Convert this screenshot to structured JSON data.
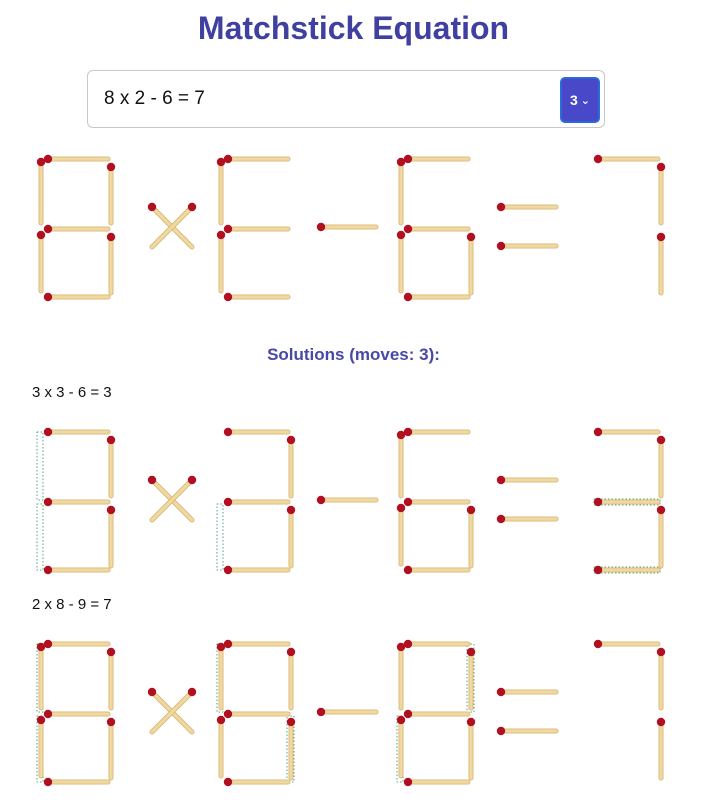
{
  "title": "Matchstick Equation",
  "equation_input": {
    "value": "8 x 2 - 6 = 7"
  },
  "moves_select": {
    "value": "3"
  },
  "colors": {
    "accent": "#4040a0",
    "stick": "#f0d9a0",
    "stick_edge": "#d8b978",
    "head": "#b01020",
    "ghost": "#2e8b57"
  },
  "puzzle": {
    "symbols": [
      {
        "kind": "digit",
        "on": [
          0,
          1,
          2,
          3,
          4,
          5,
          6
        ]
      },
      {
        "kind": "times"
      },
      {
        "kind": "digit",
        "on": [
          0,
          1,
          3,
          4,
          6
        ]
      },
      {
        "kind": "minus"
      },
      {
        "kind": "digit",
        "on": [
          0,
          1,
          3,
          4,
          5,
          6
        ]
      },
      {
        "kind": "equals"
      },
      {
        "kind": "digit",
        "on": [
          0,
          2,
          5
        ]
      }
    ]
  },
  "solutions_title": "Solutions (moves: 3):",
  "solutions": [
    {
      "label": "3 x 3 - 6 = 3",
      "symbols": [
        {
          "kind": "digit",
          "on": [
            0,
            2,
            3,
            5,
            6
          ],
          "ghost": [
            1,
            4
          ]
        },
        {
          "kind": "times"
        },
        {
          "kind": "digit",
          "on": [
            0,
            2,
            3,
            5,
            6
          ],
          "ghost": [
            4
          ]
        },
        {
          "kind": "minus"
        },
        {
          "kind": "digit",
          "on": [
            0,
            1,
            3,
            4,
            5,
            6
          ]
        },
        {
          "kind": "equals"
        },
        {
          "kind": "digit",
          "on": [
            0,
            2,
            3,
            5,
            6
          ],
          "ghost": [
            3,
            6
          ]
        }
      ]
    },
    {
      "label": "2 x 8 - 9 = 7",
      "symbols": [
        {
          "kind": "digit",
          "on": [
            0,
            1,
            2,
            3,
            4,
            5,
            6
          ],
          "ghost": [
            1,
            4
          ]
        },
        {
          "kind": "times"
        },
        {
          "kind": "digit",
          "on": [
            0,
            1,
            2,
            3,
            4,
            5,
            6
          ],
          "ghost": [
            1,
            5
          ]
        },
        {
          "kind": "minus"
        },
        {
          "kind": "digit",
          "on": [
            0,
            1,
            2,
            3,
            4,
            5,
            6
          ],
          "ghost": [
            2,
            4
          ]
        },
        {
          "kind": "equals"
        },
        {
          "kind": "digit",
          "on": [
            0,
            2,
            5
          ]
        }
      ]
    }
  ]
}
